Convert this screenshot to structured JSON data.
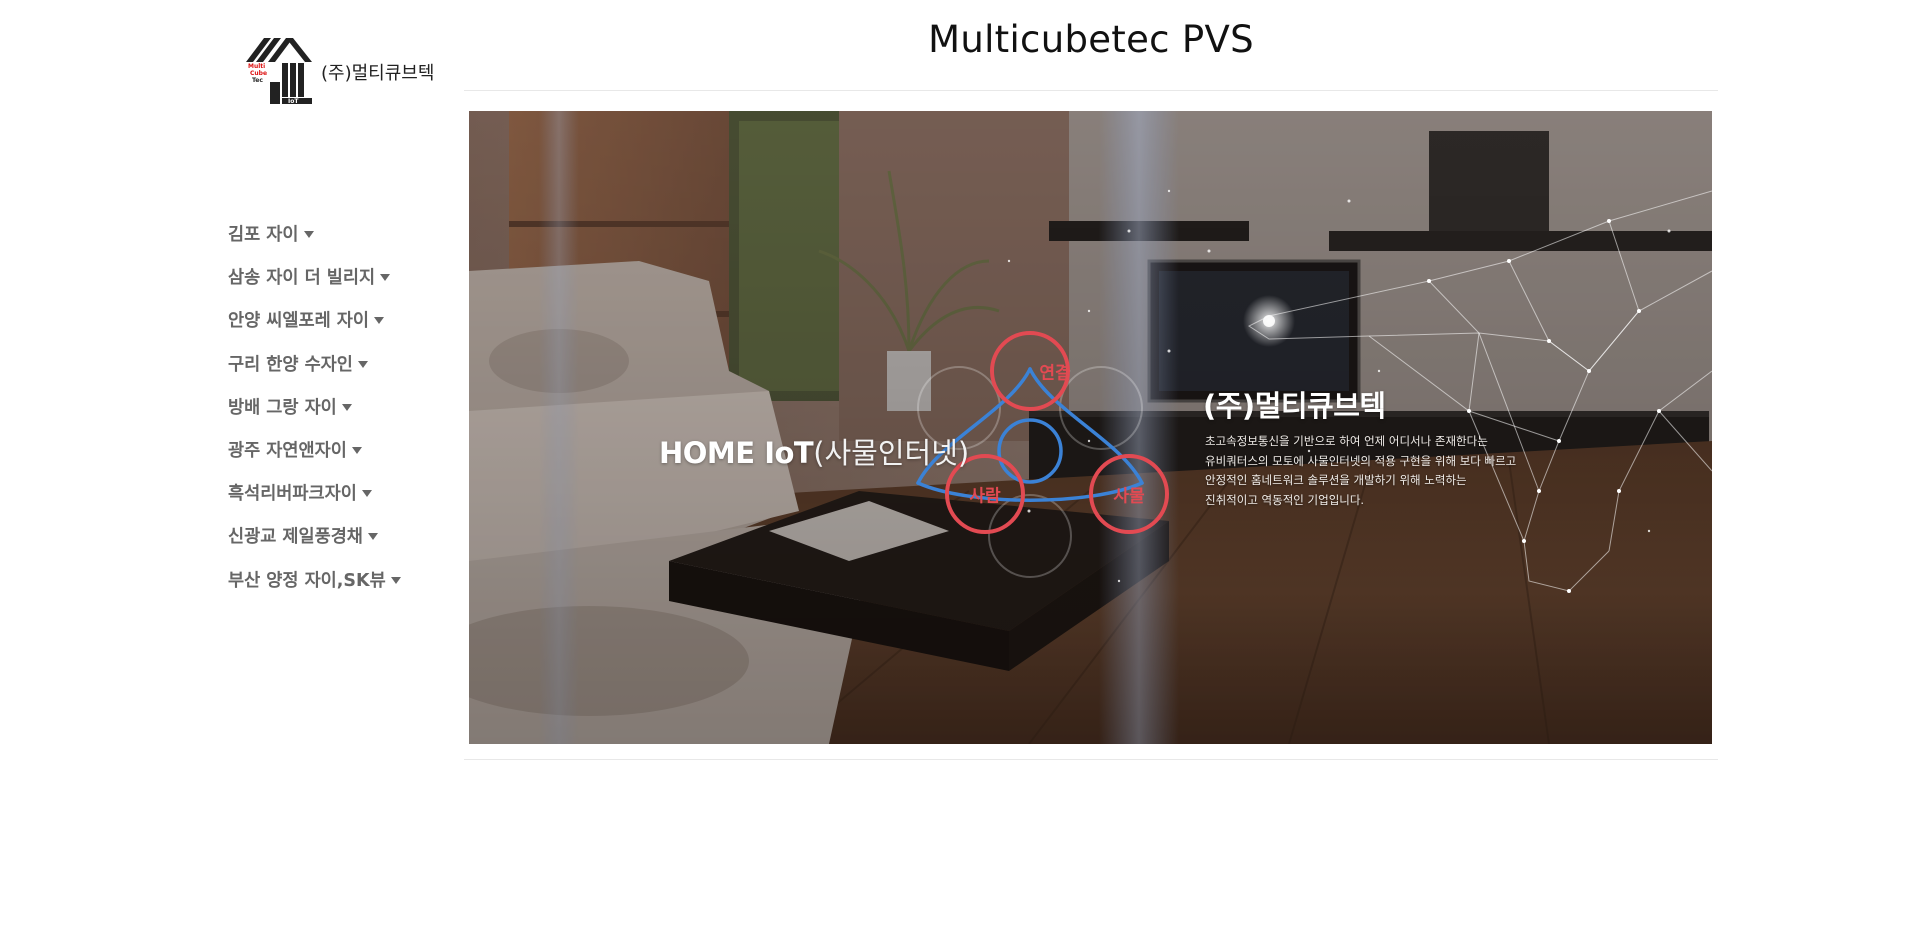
{
  "header": {
    "site_title": "Multicubetec PVS"
  },
  "logo": {
    "mark_text": [
      "Multi",
      "Cube",
      "Tec",
      "IoT"
    ],
    "company_name": "(주)멀티큐브텍"
  },
  "sidebar": {
    "items": [
      {
        "label": "김포 자이"
      },
      {
        "label": "삼송 자이 더 빌리지"
      },
      {
        "label": "안양 씨엘포레 자이"
      },
      {
        "label": "구리 한양 수자인"
      },
      {
        "label": "방배 그랑 자이"
      },
      {
        "label": "광주 자연앤자이"
      },
      {
        "label": "흑석리버파크자이"
      },
      {
        "label": "신광교 제일풍경채"
      },
      {
        "label": "부산 양정 자이,SK뷰"
      }
    ]
  },
  "banner": {
    "home_iot_strong": "HOME IoT",
    "home_iot_light": "(사물인터넷)",
    "corp_heading": "(주)멀티큐브텍",
    "corp_desc": [
      "초고속정보통신을 기반으로 하여 언제 어디서나 존재한다는",
      "유비쿼터스의 모토에 사물인터넷의 적용 구현을 위해 보다 빠르고",
      "안정적인 홈네트워크 솔루션을 개발하기 위해 노력하는",
      "진취적이고 역동적인 기업입니다."
    ],
    "diagram_nodes": {
      "top": "연결",
      "left": "사람",
      "right": "사물"
    }
  },
  "colors": {
    "node_ring": "#e24a52",
    "connector": "#3b82d6",
    "nav_text": "#666666"
  }
}
